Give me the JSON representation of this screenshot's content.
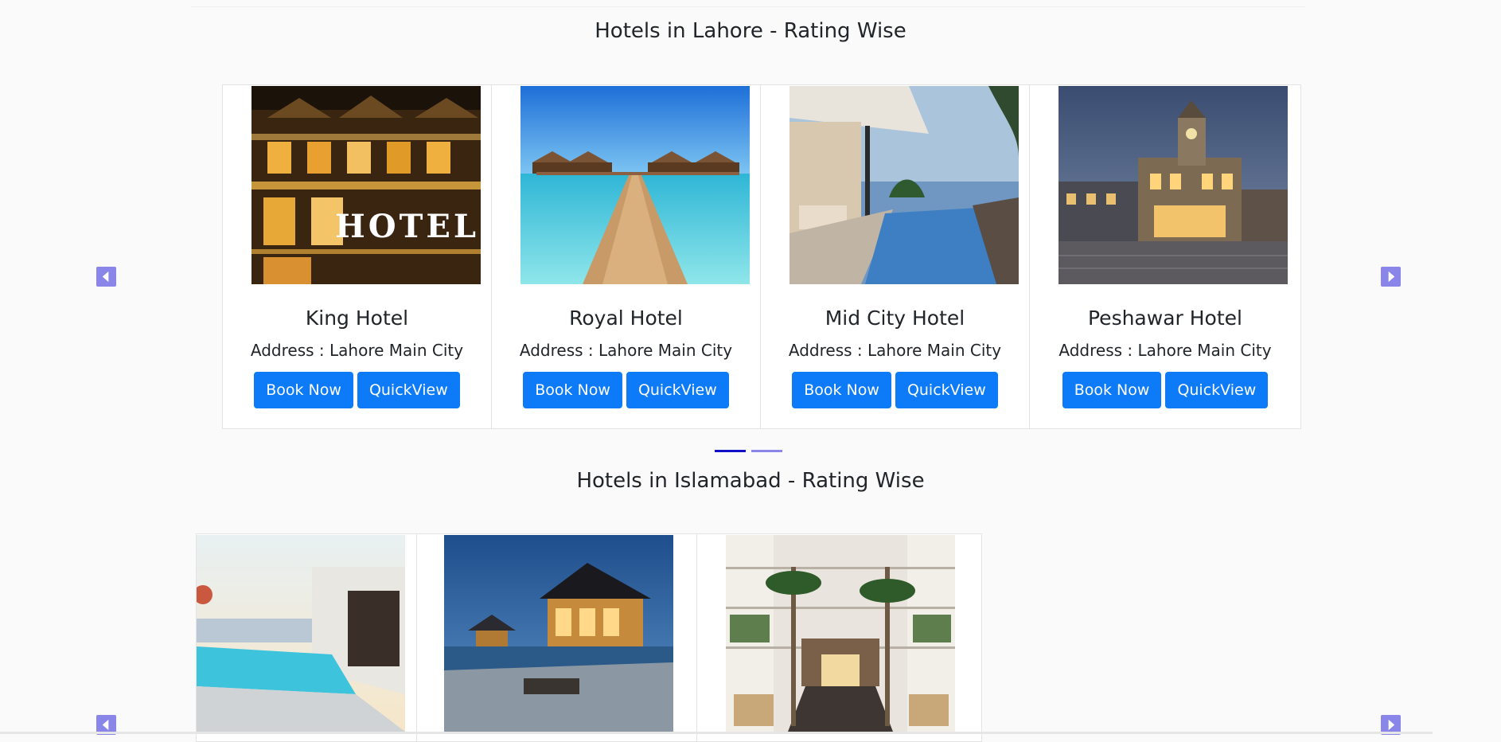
{
  "sections": [
    {
      "title": "Hotels in Lahore - Rating Wise",
      "hotels": [
        {
          "name": "King Hotel",
          "address": "Address : Lahore Main City",
          "book_label": "Book Now",
          "quickview_label": "QuickView"
        },
        {
          "name": "Royal Hotel",
          "address": "Address : Lahore Main City",
          "book_label": "Book Now",
          "quickview_label": "QuickView"
        },
        {
          "name": "Mid City Hotel",
          "address": "Address : Lahore Main City",
          "book_label": "Book Now",
          "quickview_label": "QuickView"
        },
        {
          "name": "Peshawar Hotel",
          "address": "Address : Lahore Main City",
          "book_label": "Book Now",
          "quickview_label": "QuickView"
        }
      ],
      "indicators": {
        "count": 2,
        "active_index": 0
      }
    },
    {
      "title": "Hotels in Islamabad - Rating Wise"
    }
  ],
  "colors": {
    "button": "#0d7bf7",
    "arrow": "#8a85e8",
    "indicator_active": "#1010c8"
  },
  "icons": {
    "prev": "chevron-left-icon",
    "next": "chevron-right-icon"
  }
}
